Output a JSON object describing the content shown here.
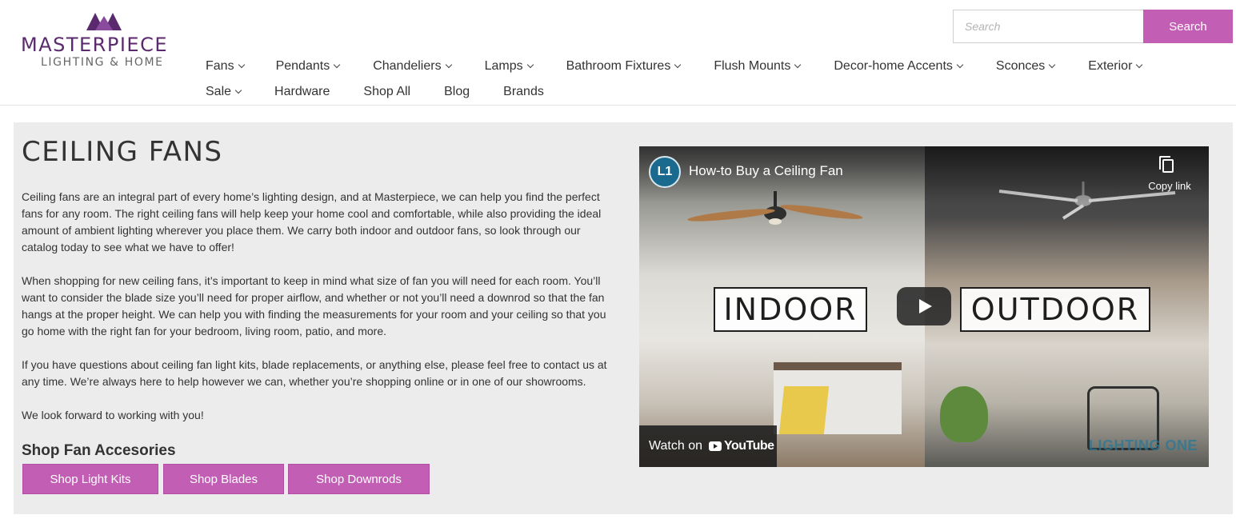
{
  "brand": {
    "name": "MASTERPIECE",
    "tagline": "LIGHTING & HOME",
    "accent": "#c35eb5",
    "logo_color": "#5b2a6e"
  },
  "search": {
    "placeholder": "Search",
    "value": "",
    "button_label": "Search"
  },
  "nav": {
    "row1": [
      {
        "label": "Fans",
        "dropdown": true
      },
      {
        "label": "Pendants",
        "dropdown": true
      },
      {
        "label": "Chandeliers",
        "dropdown": true
      },
      {
        "label": "Lamps",
        "dropdown": true
      },
      {
        "label": "Bathroom Fixtures",
        "dropdown": true
      },
      {
        "label": "Flush Mounts",
        "dropdown": true
      },
      {
        "label": "Decor-home Accents",
        "dropdown": true
      },
      {
        "label": "Sconces",
        "dropdown": true
      },
      {
        "label": "Exterior",
        "dropdown": true
      }
    ],
    "row2": [
      {
        "label": "Sale",
        "dropdown": true
      },
      {
        "label": "Hardware",
        "dropdown": false
      },
      {
        "label": "Shop All",
        "dropdown": false
      },
      {
        "label": "Blog",
        "dropdown": false
      },
      {
        "label": "Brands",
        "dropdown": false
      }
    ]
  },
  "main": {
    "title": "CEILING FANS",
    "paragraphs": [
      "Ceiling fans are an integral part of every home’s lighting design, and at Masterpiece, we can help you find the perfect fans for any room. The right ceiling fans will help keep your home cool and comfortable, while also providing the ideal amount of ambient lighting wherever you place them. We carry both indoor and outdoor fans, so look through our catalog today to see what we have to offer!",
      "When shopping for new ceiling fans, it’s important to keep in mind what size of fan you will need for each room. You’ll want to consider the blade size you’ll need for proper airflow, and whether or not you’ll need a downrod so that the fan hangs at the proper height. We can help you with finding the measurements for your room and your ceiling so that you go home with the right fan for your bedroom, living room, patio, and more.",
      "If you have questions about ceiling fan light kits, blade replacements, or anything else, please feel free to contact us at any time. We’re always here to help however we can, whether you’re shopping online or in one of our showrooms.",
      "We look forward to working with you!"
    ],
    "shop_heading": "Shop Fan Accesories",
    "shop_buttons": [
      "Shop Light Kits",
      "Shop Blades",
      "Shop Downrods"
    ]
  },
  "video": {
    "channel_logo_text": "L1",
    "title": "How-to Buy a Ceiling Fan",
    "copy_label": "Copy link",
    "indoor_label": "INDOOR",
    "outdoor_label": "OUTDOOR",
    "watch_on": "Watch on",
    "youtube_label": "YouTube",
    "watermark": "LIGHTING ONE"
  }
}
